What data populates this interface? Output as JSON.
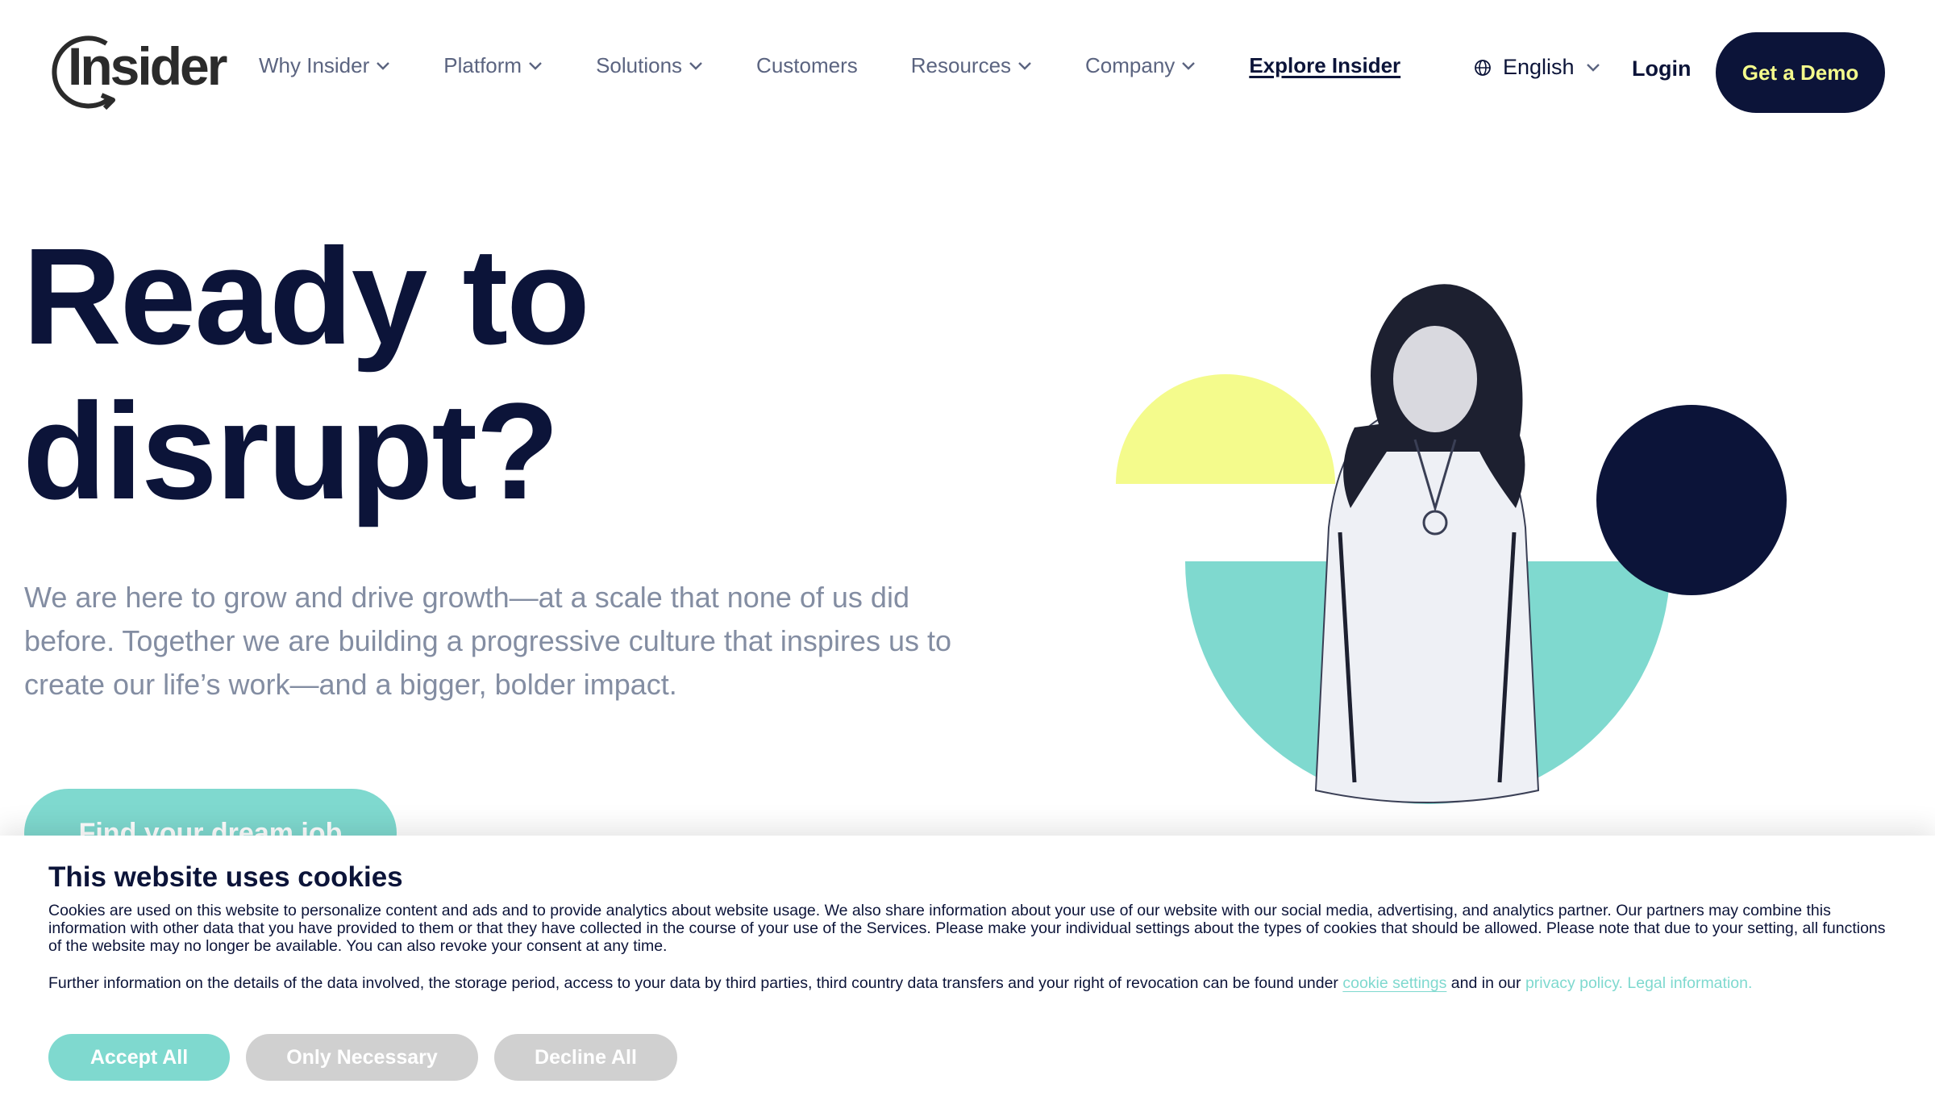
{
  "brand": {
    "logo_text": "Insider"
  },
  "nav": {
    "items": [
      {
        "label": "Why Insider",
        "has_dropdown": true
      },
      {
        "label": "Platform",
        "has_dropdown": true
      },
      {
        "label": "Solutions",
        "has_dropdown": true
      },
      {
        "label": "Customers",
        "has_dropdown": false
      },
      {
        "label": "Resources",
        "has_dropdown": true
      },
      {
        "label": "Company",
        "has_dropdown": true
      }
    ],
    "explore_label": "Explore Insider",
    "language": "English",
    "login_label": "Login",
    "demo_label": "Get a Demo"
  },
  "hero": {
    "title_line1": "Ready to",
    "title_line2": "disrupt?",
    "description": "We are here to grow and drive growth—at a scale that none of us did before. Together we are building a progressive culture that inspires us to create our life’s work—and a bigger, bolder impact.",
    "cta_label": "Find your dream job"
  },
  "cookie_banner": {
    "title": "This website uses cookies",
    "body": "Cookies are used on this website to personalize content and ads and to provide analytics about website usage. We also share information about your use of our website with our social media, advertising, and analytics partner. Our partners may combine this information with other data that you have provided to them or that they have collected in the course of your use of the Services. Please make your individual settings about the types of cookies that should be allowed. Please note that due to your setting, all functions of the website may no longer be available. You can also revoke your consent at any time.",
    "further_prefix": "Further information on the details of the data involved, the storage period, access to your data by third parties, third country data transfers and your right of revocation can be found under",
    "cookie_settings_link": "cookie settings",
    "further_middle": "and in our",
    "privacy_link": "privacy policy.",
    "legal_link": "Legal information.",
    "accept_label": "Accept All",
    "necessary_label": "Only Necessary",
    "decline_label": "Decline All"
  },
  "colors": {
    "navy": "#0c1439",
    "yellow": "#f4fb8c",
    "teal": "#7fd9cf",
    "muted_text": "#838da2",
    "disabled_button": "#d0d0d0"
  },
  "icons": {
    "language": "globe-icon",
    "dropdown": "chevron-down-icon"
  }
}
